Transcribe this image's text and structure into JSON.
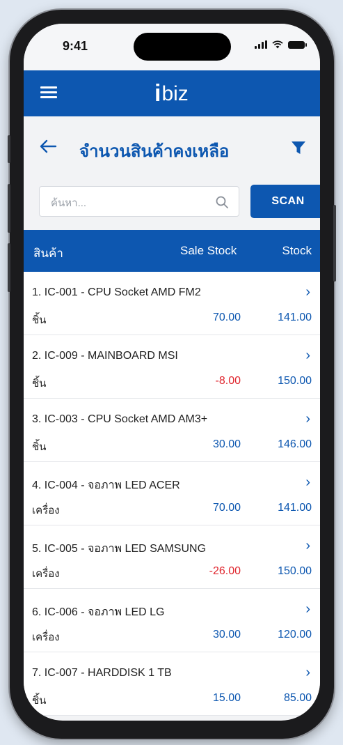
{
  "status_bar": {
    "time": "9:41"
  },
  "app": {
    "logo_mark": "i",
    "logo_text": "biz"
  },
  "page": {
    "title": "จำนวนสินค้าคงเหลือ"
  },
  "search": {
    "placeholder": "ค้นหา...",
    "value": "",
    "scan_label": "SCAN"
  },
  "table": {
    "columns": [
      "สินค้า",
      "Sale Stock",
      "Stock"
    ],
    "rows": [
      {
        "title": "1. IC-001 - CPU Socket AMD FM2",
        "unit": "ชิ้น",
        "sale_stock": "70.00",
        "stock": "141.00",
        "negative": false
      },
      {
        "title": "2. IC-009 - MAINBOARD MSI",
        "unit": "ชิ้น",
        "sale_stock": "-8.00",
        "stock": "150.00",
        "negative": true
      },
      {
        "title": "3. IC-003 - CPU Socket AMD AM3+",
        "unit": "ชิ้น",
        "sale_stock": "30.00",
        "stock": "146.00",
        "negative": false
      },
      {
        "title": "4. IC-004 - จอภาพ LED ACER",
        "unit": "เครื่อง",
        "sale_stock": "70.00",
        "stock": "141.00",
        "negative": false
      },
      {
        "title": "5. IC-005 - จอภาพ LED SAMSUNG",
        "unit": "เครื่อง",
        "sale_stock": "-26.00",
        "stock": "150.00",
        "negative": true
      },
      {
        "title": "6. IC-006 - จอภาพ LED LG",
        "unit": "เครื่อง",
        "sale_stock": "30.00",
        "stock": "120.00",
        "negative": false
      },
      {
        "title": "7. IC-007 - HARDDISK 1 TB",
        "unit": "ชิ้น",
        "sale_stock": "15.00",
        "stock": "85.00",
        "negative": false
      }
    ]
  },
  "icons": {
    "menu": "hamburger-menu-icon",
    "back": "arrow-left-icon",
    "filter": "funnel-filter-icon",
    "search": "magnifier-icon",
    "row_action": "chevron-right-icon"
  },
  "colors": {
    "primary": "#0d57b0",
    "negative": "#e0262e",
    "background": "#f2f3f5"
  }
}
